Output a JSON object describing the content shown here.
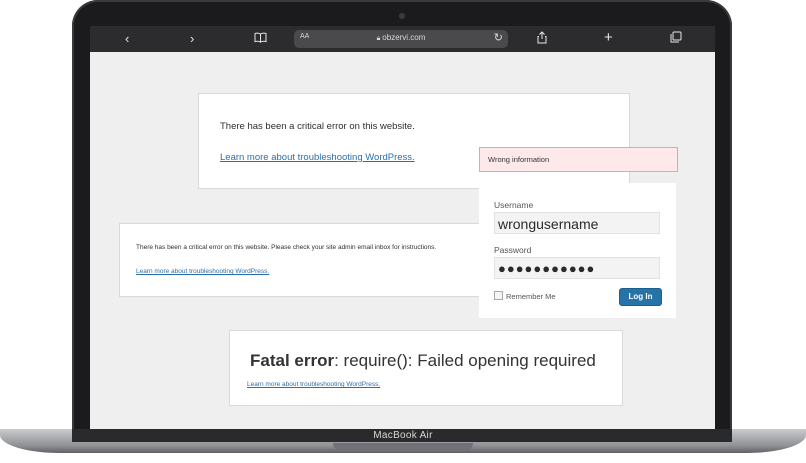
{
  "browser": {
    "aa_label": "AA",
    "url": "obzervi.com",
    "icons": [
      "chevron-left-icon",
      "chevron-right-icon",
      "book-icon",
      "lock-icon",
      "reload-icon",
      "share-icon",
      "plus-icon",
      "tabs-icon"
    ]
  },
  "cards": {
    "card1": {
      "message": "There has been a critical error on this website.",
      "link": "Learn more about troubleshooting WordPress."
    },
    "card2": {
      "message": "There has been a critical error on this website. Please check your site admin email inbox for instructions.",
      "link": "Learn more about troubleshooting WordPress."
    },
    "card3": {
      "fatal_label": "Fatal error",
      "fatal_text": ": require(): Failed opening required",
      "link": "Learn more about troubleshooting WordPress."
    }
  },
  "login": {
    "error": "Wrong information",
    "username_label": "Username",
    "username_value": "wrongusername",
    "password_label": "Password",
    "password_value": "●●●●●●●●●●●",
    "remember_label": "Remember Me",
    "login_button": "Log In"
  },
  "device": {
    "label": "MacBook Air"
  },
  "colors": {
    "link": "#2b6fa8",
    "button": "#2573a7",
    "error_bg": "#fde9e9",
    "error_border": "#e9a3a3"
  }
}
